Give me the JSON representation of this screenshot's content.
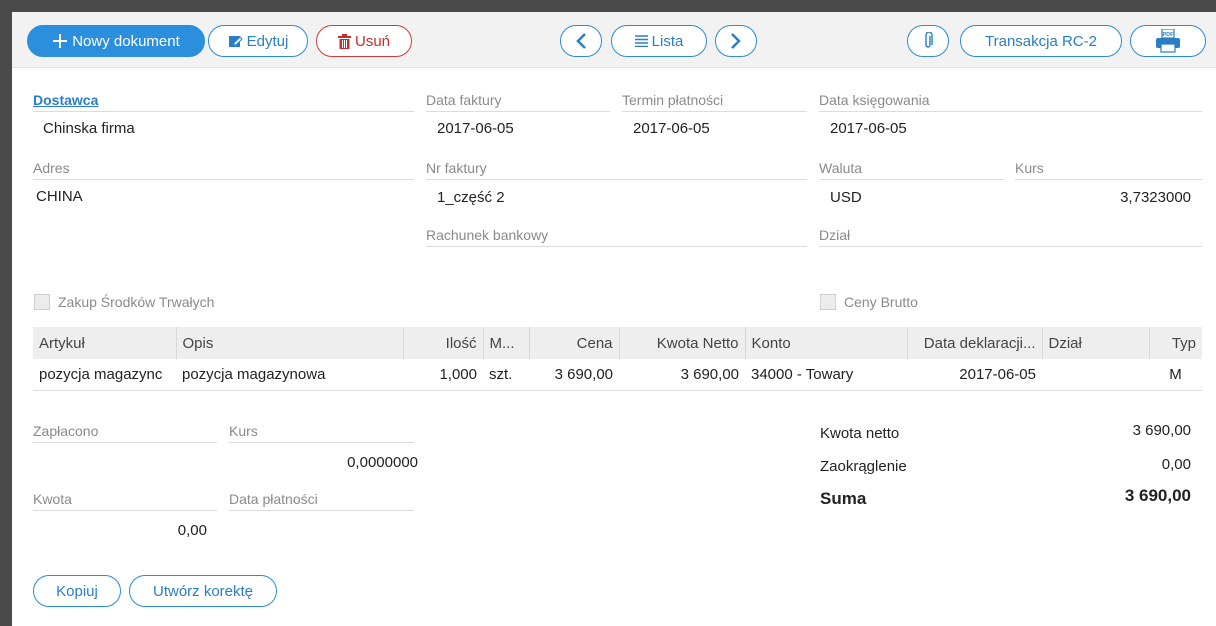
{
  "toolbar": {
    "new_label": "Nowy dokument",
    "edit_label": "Edytuj",
    "delete_label": "Usuń",
    "list_label": "Lista",
    "transaction_label": "Transakcja RC-2"
  },
  "header": {
    "supplier_label": "Dostawca",
    "supplier_value": "Chinska firma",
    "invoice_date_label": "Data faktury",
    "invoice_date_value": "2017-06-05",
    "payment_due_label": "Termin płatności",
    "payment_due_value": "2017-06-05",
    "posting_date_label": "Data księgowania",
    "posting_date_value": "2017-06-05",
    "address_label": "Adres",
    "address_value": "CHINA",
    "invoice_no_label": "Nr faktury",
    "invoice_no_value": "1_część 2",
    "currency_label": "Waluta",
    "currency_value": "USD",
    "rate_label": "Kurs",
    "rate_value": "3,7323000",
    "bank_account_label": "Rachunek bankowy",
    "department_label": "Dział"
  },
  "checkboxes": {
    "fixed_assets_label": "Zakup Środków Trwałych",
    "gross_prices_label": "Ceny Brutto"
  },
  "table": {
    "columns": [
      "Artykuł",
      "Opis",
      "Ilość",
      "M...",
      "Cena",
      "Kwota Netto",
      "Konto",
      "Data deklaracji...",
      "Dział",
      "Typ"
    ],
    "rows": [
      [
        "pozycja magazync",
        "pozycja magazynowa",
        "1,000",
        "szt.",
        "3 690,00",
        "3 690,00",
        "34000 - Towary",
        "2017-06-05",
        "",
        "M"
      ]
    ]
  },
  "payment": {
    "paid_label": "Zapłacono",
    "rate_label": "Kurs",
    "rate_value": "0,0000000",
    "amount_label": "Kwota",
    "amount_value": "0,00",
    "payment_date_label": "Data płatności"
  },
  "totals": {
    "net_label": "Kwota netto",
    "net_value": "3 690,00",
    "rounding_label": "Zaokrąglenie",
    "rounding_value": "0,00",
    "sum_label": "Suma",
    "sum_value": "3 690,00"
  },
  "footer": {
    "copy_label": "Kopiuj",
    "correction_label": "Utwórz korektę"
  },
  "colors": {
    "accent": "#2b8fde",
    "danger": "#d13b3b"
  }
}
